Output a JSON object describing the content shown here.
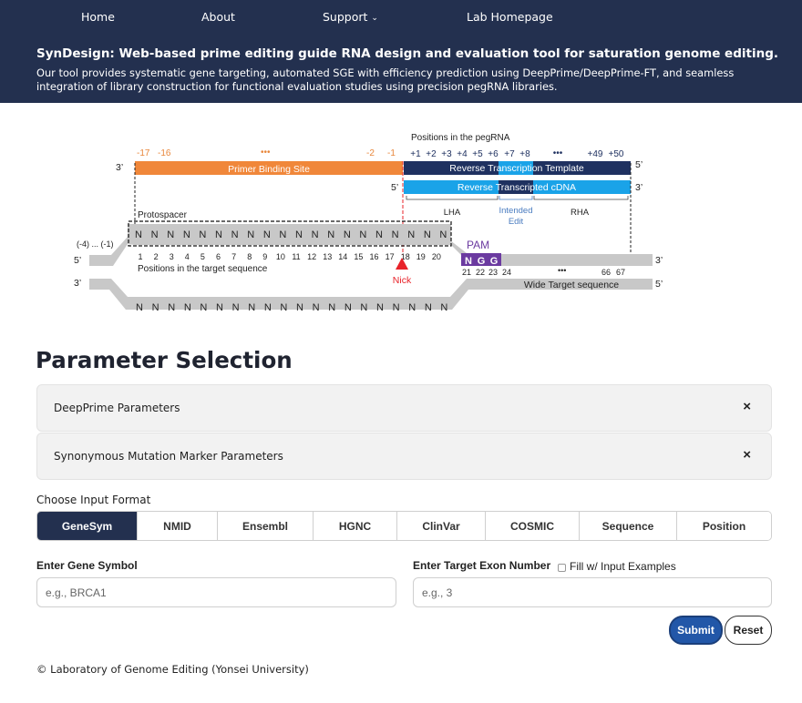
{
  "nav": {
    "items": [
      {
        "label": "Home"
      },
      {
        "label": "About"
      },
      {
        "label": "Support"
      },
      {
        "label": "Lab Homepage"
      }
    ]
  },
  "header": {
    "title": "SynDesign: Web-based prime editing guide RNA design and evaluation tool for saturation genome editing.",
    "description": "Our tool provides systematic gene targeting, automated SGE with efficiency prediction using DeepPrime/DeepPrime-FT, and seamless integration of library construction for functional evaluation studies using precision pegRNA libraries."
  },
  "diagram": {
    "positions_pegrna_label": "Positions in the pegRNA",
    "pbs_numbers": [
      "-17",
      "-16",
      "-2",
      "-1"
    ],
    "rtt_numbers": [
      "+1",
      "+2",
      "+3",
      "+4",
      "+5",
      "+6",
      "+7",
      "+8",
      "+49",
      "+50"
    ],
    "ellipsis": "•••",
    "pbs_label": "Primer Binding Site",
    "rtt_label": "Reverse Transcription Template",
    "cdna_label": "Reverse Transcripted cDNA",
    "end_3": "3’",
    "end_5": "5’",
    "lha_label": "LHA",
    "intended_edit_line1": "Intended",
    "intended_edit_line2": "Edit",
    "rha_label": "RHA",
    "protospacer_label": "Protospacer",
    "left_range": "(-4) ... (-1)",
    "n_base": "N",
    "pam_label": "PAM",
    "pam_bases": [
      "N",
      "G",
      "G"
    ],
    "target_positions": [
      "1",
      "2",
      "3",
      "4",
      "5",
      "6",
      "7",
      "8",
      "9",
      "10",
      "11",
      "12",
      "13",
      "14",
      "15",
      "16",
      "17",
      "18",
      "19",
      "20"
    ],
    "positions_target_label": "Positions in the target sequence",
    "nick_label": "Nick",
    "right_positions": [
      "21",
      "22",
      "23",
      "24",
      "66",
      "67"
    ],
    "wide_target_label": "Wide Target sequence"
  },
  "params": {
    "title": "Parameter Selection",
    "accordions": [
      {
        "label": "DeepPrime Parameters",
        "close": "×"
      },
      {
        "label": "Synonymous Mutation Marker Parameters",
        "close": "×"
      }
    ]
  },
  "input_format": {
    "label": "Choose Input Format",
    "active": "GeneSym",
    "tabs": [
      {
        "label": "GeneSym"
      },
      {
        "label": "NMID"
      },
      {
        "label": "Ensembl"
      },
      {
        "label": "HGNC"
      },
      {
        "label": "ClinVar"
      },
      {
        "label": "COSMIC"
      },
      {
        "label": "Sequence"
      },
      {
        "label": "Position"
      }
    ]
  },
  "form": {
    "gene_label": "Enter Gene Symbol",
    "gene_placeholder": "e.g., BRCA1",
    "exon_label": "Enter Target Exon Number",
    "exon_placeholder": "e.g., 3",
    "fill_examples_label": "Fill w/ Input Examples",
    "submit_label": "Submit",
    "reset_label": "Reset"
  },
  "footer": {
    "text": "© Laboratory of Genome Editing (Yonsei University)"
  },
  "colors": {
    "header_bg": "#23304f",
    "pbs_orange": "#f0873a",
    "rtt_navy": "#1f3160",
    "cdna_blue": "#1aa3e8",
    "pam_purple": "#6b3aa0",
    "nick_red": "#e8232a",
    "submit_blue": "#2257a8"
  }
}
